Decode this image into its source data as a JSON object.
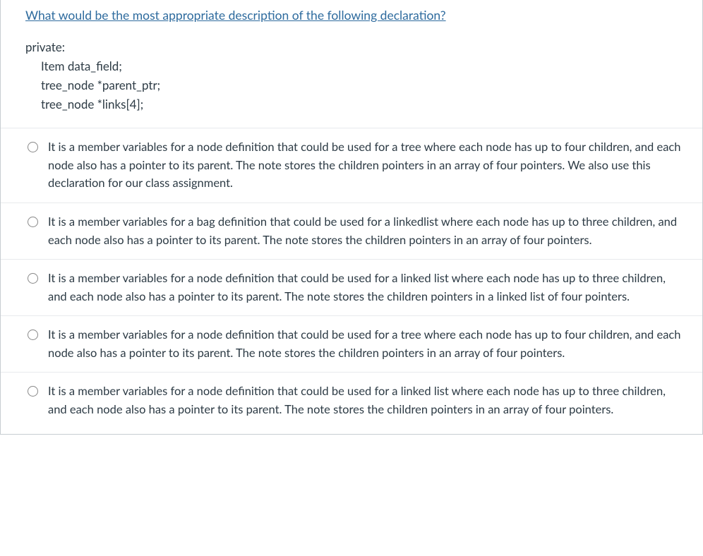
{
  "question": {
    "title": "What would be the most appropriate description of the following declaration?",
    "code_lines": [
      "private:",
      "Item data_field;",
      "tree_node *parent_ptr;",
      "tree_node *links[4];"
    ]
  },
  "options": [
    {
      "text": "It is a member variables for a node definition that could be used for a tree where each node has up to four children, and each node also has a pointer to its parent. The note stores the children pointers in an array of four pointers. We also use this declaration for our class assignment."
    },
    {
      "text": "It is a member variables for a bag definition that could be used for a linkedlist where each node has up to three children, and each node also has a pointer to its parent. The note stores the children pointers in an array of four pointers."
    },
    {
      "text": "It is a member variables for a node definition that could be used for a linked list where each node has up to three children, and each node also has a pointer to its parent. The note stores the children pointers in a linked list of four pointers."
    },
    {
      "text": "It is a member variables for a node definition that could be used for a tree where each node has up to four children, and each node also has a pointer to its parent. The note stores the children pointers in an array of four pointers."
    },
    {
      "text": "It is a member variables for a node definition that could be used for a linked list where each node has up to three children, and each node also has a pointer to its parent. The note stores the children pointers in an array of four pointers."
    }
  ]
}
